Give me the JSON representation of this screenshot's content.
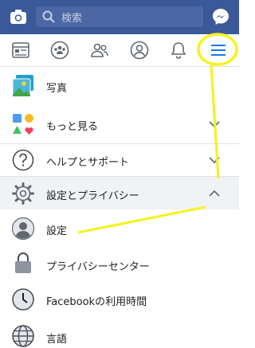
{
  "search": {
    "placeholder": "検索"
  },
  "menu": {
    "items": [
      {
        "label": "写真"
      },
      {
        "label": "もっと見る"
      },
      {
        "label": "ヘルプとサポート"
      },
      {
        "label": "設定とプライバシー"
      },
      {
        "label": "設定"
      },
      {
        "label": "プライバシーセンター"
      },
      {
        "label": "Facebookの利用時間"
      },
      {
        "label": "言語"
      }
    ]
  },
  "colors": {
    "brand": "#3b5998",
    "annotation": "#f6f21a"
  }
}
